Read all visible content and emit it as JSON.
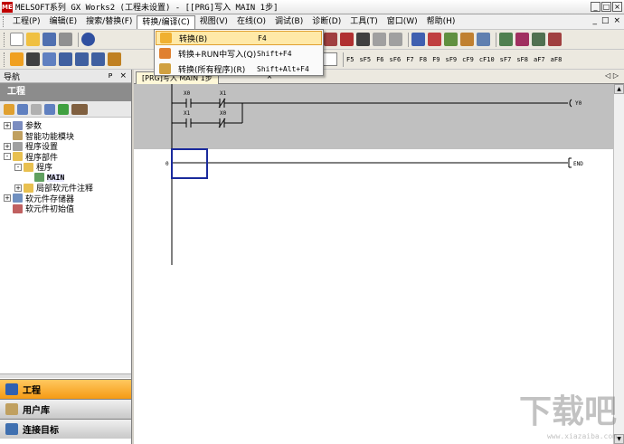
{
  "window": {
    "title": "MELSOFT系列 GX Works2 (工程未设置) - [[PRG]写入 MAIN 1步]",
    "logo_text": "MEL",
    "minimize": "_",
    "restore": "□",
    "close": "×"
  },
  "menu": {
    "items": [
      "工程(P)",
      "编辑(E)",
      "搜索/替换(F)",
      "转换/编译(C)",
      "视图(V)",
      "在线(O)",
      "调试(B)",
      "诊断(D)",
      "工具(T)",
      "窗口(W)",
      "帮助(H)"
    ],
    "mdi_minimize": "_",
    "mdi_restore": "□",
    "mdi_close": "×"
  },
  "dropdown": {
    "items": [
      {
        "label": "转换(B)",
        "shortcut": "F4"
      },
      {
        "label": "转换+RUN中写入(Q)",
        "shortcut": "Shift+F4"
      },
      {
        "label": "转换(所有程序)(R)",
        "shortcut": "Shift+Alt+F4"
      }
    ]
  },
  "toolbar2_labels": [
    "F5",
    "sF5",
    "F6",
    "sF6",
    "F7",
    "F8",
    "F9",
    "sF9",
    "cF9",
    "cF10",
    "sF7",
    "sF8",
    "aF7",
    "aF8"
  ],
  "nav": {
    "header": "导航",
    "pin": "ᴘ",
    "close": "×",
    "title": "工程",
    "tree": [
      {
        "label": "参数",
        "exp": "+",
        "indent": 0,
        "icon": "#7a8cc0"
      },
      {
        "label": "智能功能模块",
        "exp": "",
        "indent": 0,
        "icon": "#c0a060"
      },
      {
        "label": "程序设置",
        "exp": "+",
        "indent": 0,
        "icon": "#a0a0a0"
      },
      {
        "label": "程序部件",
        "exp": "-",
        "indent": 0,
        "icon": "#e8c050"
      },
      {
        "label": "程序",
        "exp": "-",
        "indent": 1,
        "icon": "#e8c050"
      },
      {
        "label": "MAIN",
        "exp": "",
        "indent": 2,
        "icon": "#60a060"
      },
      {
        "label": "局部软元件注释",
        "exp": "+",
        "indent": 1,
        "icon": "#e8c050"
      },
      {
        "label": "软元件存储器",
        "exp": "+",
        "indent": 0,
        "icon": "#7090c0"
      },
      {
        "label": "软元件初始值",
        "exp": "",
        "indent": 0,
        "icon": "#c06060"
      }
    ],
    "tabs": {
      "project": "工程",
      "library": "用户库",
      "connection": "连接目标"
    }
  },
  "editor": {
    "tab": "[PRG]写入 MAIN 1步",
    "tab_close": "×",
    "scroll_left": "◁",
    "scroll_right": "▷",
    "scroll_up": "▲",
    "scroll_down": "▼",
    "ladder": {
      "contacts": [
        "X0",
        "X1",
        "X1",
        "X0"
      ],
      "coil": "Y0",
      "end_step": "0",
      "end_label": "END"
    }
  },
  "watermark": {
    "big": "下载吧",
    "small": "www.xiazaiba.com"
  },
  "colors": {
    "accent": "#f59a14",
    "cursor": "#1a2a9c",
    "hover": "#ffe9a8"
  }
}
